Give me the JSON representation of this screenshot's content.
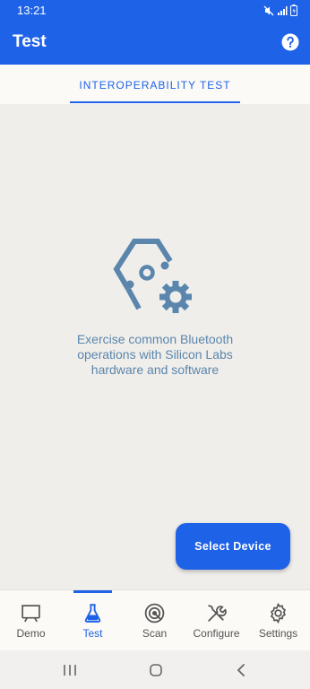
{
  "status_bar": {
    "time": "13:21"
  },
  "app_bar": {
    "title": "Test"
  },
  "tabs": [
    {
      "label": "INTEROPERABILITY TEST"
    }
  ],
  "content": {
    "message_lines": [
      "Exercise common Bluetooth",
      "operations with Silicon Labs",
      "hardware and software"
    ]
  },
  "fab": {
    "label": "Select Device"
  },
  "bottom_nav": {
    "items": [
      {
        "label": "Demo",
        "icon": "presentation-icon"
      },
      {
        "label": "Test",
        "icon": "flask-icon",
        "active": true
      },
      {
        "label": "Scan",
        "icon": "scan-target-icon"
      },
      {
        "label": "Configure",
        "icon": "tools-icon"
      },
      {
        "label": "Settings",
        "icon": "gear-icon"
      }
    ]
  },
  "colors": {
    "primary": "#1e62e8",
    "background": "#f0eeea",
    "hero": "#5a86ad"
  }
}
